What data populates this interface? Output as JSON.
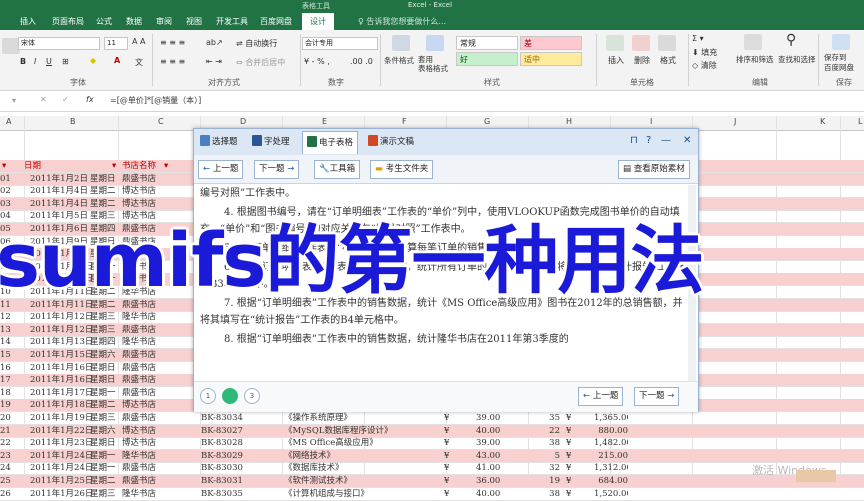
{
  "title_bar": {
    "context_tab": "表格工具",
    "title": "Excel - Excel"
  },
  "tabs": [
    "插入",
    "页面布局",
    "公式",
    "数据",
    "审阅",
    "视图",
    "开发工具",
    "百度网盘",
    "设计"
  ],
  "tell_me": "告诉我您想要做什么...",
  "ribbon": {
    "font_name": "宋体",
    "font_size": "11",
    "wrap_text": "自动换行",
    "merge_center": "合并后居中",
    "number_format": "会计专用",
    "conditional_format": "条件格式",
    "table_format": "套用\n表格格式",
    "styles": {
      "normal": "常规",
      "bad": "差",
      "good": "好",
      "neutral": "适中"
    },
    "insert": "插入",
    "delete": "删除",
    "format": "格式",
    "fill": "填充",
    "clear": "清除",
    "sort_filter": "排序和筛选",
    "find_select": "查找和选择",
    "save_baidu": "保存到\n百度网盘",
    "groups": {
      "font": "字体",
      "alignment": "对齐方式",
      "number": "数字",
      "styles": "样式",
      "cells": "单元格",
      "editing": "编辑",
      "save": "保存"
    }
  },
  "formula_bar": {
    "fx": "fx",
    "formula": "=[@单价]*[@销量（本）]"
  },
  "columns": [
    "A",
    "B",
    "C",
    "D",
    "E",
    "F",
    "G",
    "H",
    "I",
    "J",
    "K",
    "L"
  ],
  "sheet": {
    "header": {
      "date": "日期",
      "bookstore": "书店名称"
    },
    "rows": [
      {
        "n": "01",
        "date": "2011年1月2日",
        "wd": "星期日",
        "store": "鼎盛书店"
      },
      {
        "n": "02",
        "date": "2011年1月4日",
        "wd": "星期二",
        "store": "博达书店"
      },
      {
        "n": "03",
        "date": "2011年1月4日",
        "wd": "星期二",
        "store": "博达书店"
      },
      {
        "n": "04",
        "date": "2011年1月5日",
        "wd": "星期三",
        "store": "博达书店"
      },
      {
        "n": "05",
        "date": "2011年1月6日",
        "wd": "星期四",
        "store": "鼎盛书店"
      },
      {
        "n": "06",
        "date": "2011年1月9日",
        "wd": "星期日",
        "store": "鼎盛书店"
      },
      {
        "n": "07",
        "date": "2011年1月9日",
        "wd": "星期日",
        "store": "博达书店"
      },
      {
        "n": "08",
        "date": "2011年1月10日",
        "wd": "星期一",
        "store": "鼎盛书店"
      },
      {
        "n": "09",
        "date": "2011年1月10日",
        "wd": "星期一",
        "store": "博达书店"
      },
      {
        "n": "10",
        "date": "2011年1月11日",
        "wd": "星期二",
        "store": "隆华书店"
      },
      {
        "n": "11",
        "date": "2011年1月11日",
        "wd": "星期二",
        "store": "鼎盛书店"
      },
      {
        "n": "12",
        "date": "2011年1月12日",
        "wd": "星期三",
        "store": "隆华书店"
      },
      {
        "n": "13",
        "date": "2011年1月12日",
        "wd": "星期三",
        "store": "鼎盛书店"
      },
      {
        "n": "14",
        "date": "2011年1月13日",
        "wd": "星期四",
        "store": "隆华书店"
      },
      {
        "n": "15",
        "date": "2011年1月15日",
        "wd": "星期六",
        "store": "鼎盛书店"
      },
      {
        "n": "16",
        "date": "2011年1月16日",
        "wd": "星期日",
        "store": "鼎盛书店"
      },
      {
        "n": "17",
        "date": "2011年1月16日",
        "wd": "星期日",
        "store": "鼎盛书店"
      },
      {
        "n": "18",
        "date": "2011年1月17日",
        "wd": "星期一",
        "store": "鼎盛书店"
      },
      {
        "n": "19",
        "date": "2011年1月18日",
        "wd": "星期二",
        "store": "博达书店"
      },
      {
        "n": "20",
        "date": "2011年1月19日",
        "wd": "星期三",
        "store": "鼎盛书店",
        "code": "BK-83034",
        "book": "《操作系统原理》",
        "cur": "¥",
        "price": "39.00",
        "qty": "35",
        "cur2": "¥",
        "amount": "1,365.00"
      },
      {
        "n": "21",
        "date": "2011年1月22日",
        "wd": "星期六",
        "store": "博达书店",
        "code": "BK-83027",
        "book": "《MySQL数据库程序设计》",
        "cur": "¥",
        "price": "40.00",
        "qty": "22",
        "cur2": "¥",
        "amount": "880.00"
      },
      {
        "n": "22",
        "date": "2011年1月23日",
        "wd": "星期日",
        "store": "博达书店",
        "code": "BK-83028",
        "book": "《MS Office高级应用》",
        "cur": "¥",
        "price": "39.00",
        "qty": "38",
        "cur2": "¥",
        "amount": "1,482.00"
      },
      {
        "n": "23",
        "date": "2011年1月24日",
        "wd": "星期一",
        "store": "隆华书店",
        "code": "BK-83029",
        "book": "《网络技术》",
        "cur": "¥",
        "price": "43.00",
        "qty": "5",
        "cur2": "¥",
        "amount": "215.00"
      },
      {
        "n": "24",
        "date": "2011年1月24日",
        "wd": "星期一",
        "store": "鼎盛书店",
        "code": "BK-83030",
        "book": "《数据库技术》",
        "cur": "¥",
        "price": "41.00",
        "qty": "32",
        "cur2": "¥",
        "amount": "1,312.00"
      },
      {
        "n": "25",
        "date": "2011年1月25日",
        "wd": "星期二",
        "store": "鼎盛书店",
        "code": "BK-83031",
        "book": "《软件测试技术》",
        "cur": "¥",
        "price": "36.00",
        "qty": "19",
        "cur2": "¥",
        "amount": "684.00"
      },
      {
        "n": "26",
        "date": "2011年1月26日",
        "wd": "星期三",
        "store": "隆华书店",
        "code": "BK-83035",
        "book": "《计算机组成与接口》",
        "cur": "¥",
        "price": "40.00",
        "qty": "38",
        "cur2": "¥",
        "amount": "1,520.00"
      }
    ]
  },
  "dialog": {
    "tabs": [
      "选择题",
      "字处理",
      "电子表格",
      "演示文稿"
    ],
    "window_buttons": [
      "⊓",
      "?",
      "—",
      "□",
      "✕"
    ],
    "toolbar": {
      "prev": "上一题",
      "next": "下一题",
      "toolbox": "工具箱",
      "exam_folder": "考生文件夹",
      "view_source": "查看原始素材"
    },
    "paragraphs": [
      "编号对照”工作表中。",
      "4. 根据图书编号，请在“订单明细表”工作表的“单价”列中，使用VLOOKUP函数完成图书单价的自动填充。“单价”和“图书编号”的对应关系在“编号对照”工作表中。",
      "5. 在“订单明细”工作表的“小计”列中，计算每笔订单的销售额。",
      "6. 根据“订单明细表”工作表中的销售数据，统计所有订单的总销售金额，并将其填写在“统计报告”工作表的B3单元格中。",
      "7. 根据“订单明细表”工作表中的销售数据，统计《MS Office高级应用》图书在2012年的总销售额，并将其填写在“统计报告”工作表的B4单元格中。",
      "8. 根据“订单明细表”工作表中的销售数据，统计隆华书店在2011年第3季度的"
    ],
    "pages": [
      "1",
      "2",
      "3"
    ],
    "footer": {
      "prev": "上一题",
      "next": "下一题"
    }
  },
  "overlay_text": "sumifs的第一种用法",
  "watermark": "激活 Windows",
  "colors": {
    "excel_green": "#217346",
    "header_red": "#c00000",
    "row_pink": "#f8d0cf",
    "overlay_blue": "#1a1ad8",
    "page_current": "#2eb87a"
  }
}
